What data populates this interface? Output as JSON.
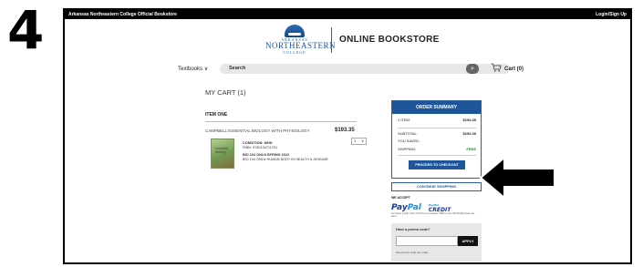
{
  "step_number": "4",
  "topbar": {
    "site_name": "Arkansas Northeastern College Official Bookstore",
    "login_link": "Login/Sign Up"
  },
  "logo": {
    "line_top": "ARKANSAS",
    "line_main": "NORTHEASTERN",
    "line_bottom": "COLLEGE"
  },
  "store_title": "ONLINE BOOKSTORE",
  "nav": {
    "textbooks_label": "Textbooks",
    "textbooks_caret": "∨",
    "search_placeholder": "Search",
    "search_icon_glyph": "⌕",
    "cart_icon_glyph": "🛒",
    "cart_label": "Cart (0)"
  },
  "cart": {
    "title": "MY CART (1)",
    "item_heading": "ITEM ONE",
    "product_title": "CAMPBELL ESSENTIAL BIOLOGY WITH PHYSIOLOGY",
    "price": "$193.35",
    "quantity": "1",
    "quantity_caret": "∨",
    "book_cover_text": "essential biology",
    "condition": "CONDITION: NEW",
    "isbn": "ISBN: 9780134711751",
    "course_line_1": "BIO 104 ONLN SPRING 2022",
    "course_line_2": "BIO 104 ONLN HUMAN BODY IN HEALTH & DISEASE"
  },
  "summary": {
    "heading": "ORDER SUMMARY",
    "rows": [
      {
        "label": "1 ITEM:",
        "value": "$193.35"
      },
      {
        "label": "SUBTOTAL:",
        "value": "$193.35"
      },
      {
        "label": "YOU SAVED:",
        "value": ""
      },
      {
        "label": "SHIPPING:",
        "value": "FREE"
      }
    ],
    "checkout_label": "PROCEED TO CHECKOUT"
  },
  "continue_shopping_label": "CONTINUE SHOPPING",
  "payments": {
    "we_accept": "WE ACCEPT",
    "paypal_pay": "Pay",
    "paypal_pal": "Pal",
    "paypal_credit_top": "PayPal",
    "paypal_credit_main": "CREDIT",
    "fine_print": "No Interest if paid in full in 6 months on purchases of $99 or more with PayPal Credit. See terms."
  },
  "promo": {
    "label": "Have a promo code?",
    "input_value": "",
    "apply_label": "APPLY",
    "note": "One promo code per order."
  },
  "colors": {
    "brand_blue": "#1f5599",
    "free_green": "#2a8a2a",
    "topbar": "#000000"
  }
}
